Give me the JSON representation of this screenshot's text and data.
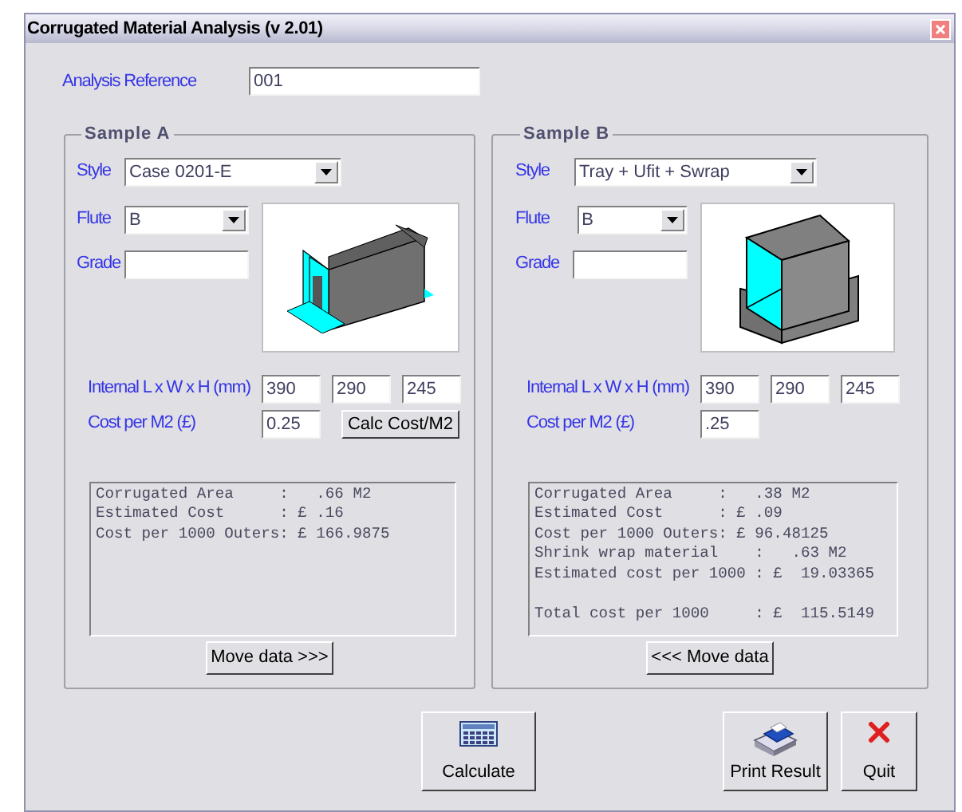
{
  "window": {
    "title": "Corrugated Material Analysis (v 2.01)"
  },
  "analysis_reference": {
    "label": "Analysis Reference",
    "value": "001"
  },
  "samples": [
    {
      "title": "Sample A",
      "kind": "case",
      "style_label": "Style",
      "style": "Case 0201-E",
      "flute_label": "Flute",
      "flute": "B",
      "grade_label": "Grade",
      "dims_label": "Internal L x W x H (mm)",
      "dims": [
        "390",
        "290",
        "245"
      ],
      "cost_label": "Cost per M2 (£)",
      "cost": "0.25",
      "calc_button": "Calc Cost/M2",
      "results": [
        {
          "text": "Corrugated Area     :   .66 M2",
          "gap_before": false
        },
        {
          "text": "Estimated Cost      : £ .16",
          "gap_before": false
        },
        {
          "text": "Cost per 1000 Outers: £ 166.9875",
          "gap_before": false
        }
      ],
      "move_button": "Move data >>>"
    },
    {
      "title": "Sample B",
      "kind": "tray",
      "style_label": "Style",
      "style": "Tray + Ufit + Swrap",
      "flute_label": "Flute",
      "flute": "B",
      "grade_label": "Grade",
      "dims_label": "Internal L x W x H (mm)",
      "dims": [
        "390",
        "290",
        "245"
      ],
      "cost_label": "Cost per M2 (£)",
      "cost": ".25",
      "results": [
        {
          "text": "Corrugated Area     :   .38 M2",
          "gap_before": false
        },
        {
          "text": "Estimated Cost      : £ .09",
          "gap_before": false
        },
        {
          "text": "Cost per 1000 Outers: £ 96.48125",
          "gap_before": false
        },
        {
          "text": "Shrink wrap material    :   .63 M2",
          "gap_before": false
        },
        {
          "text": "Estimated cost per 1000 : £  19.03365",
          "gap_before": false
        },
        {
          "text": "Total cost per 1000     : £  115.5149",
          "gap_before": true
        }
      ],
      "move_button": "<<< Move data"
    }
  ],
  "buttons": [
    {
      "kind": "calculate",
      "label": "Calculate"
    },
    {
      "kind": "print",
      "label": "Print Result"
    },
    {
      "kind": "quit",
      "label": "Quit"
    }
  ]
}
